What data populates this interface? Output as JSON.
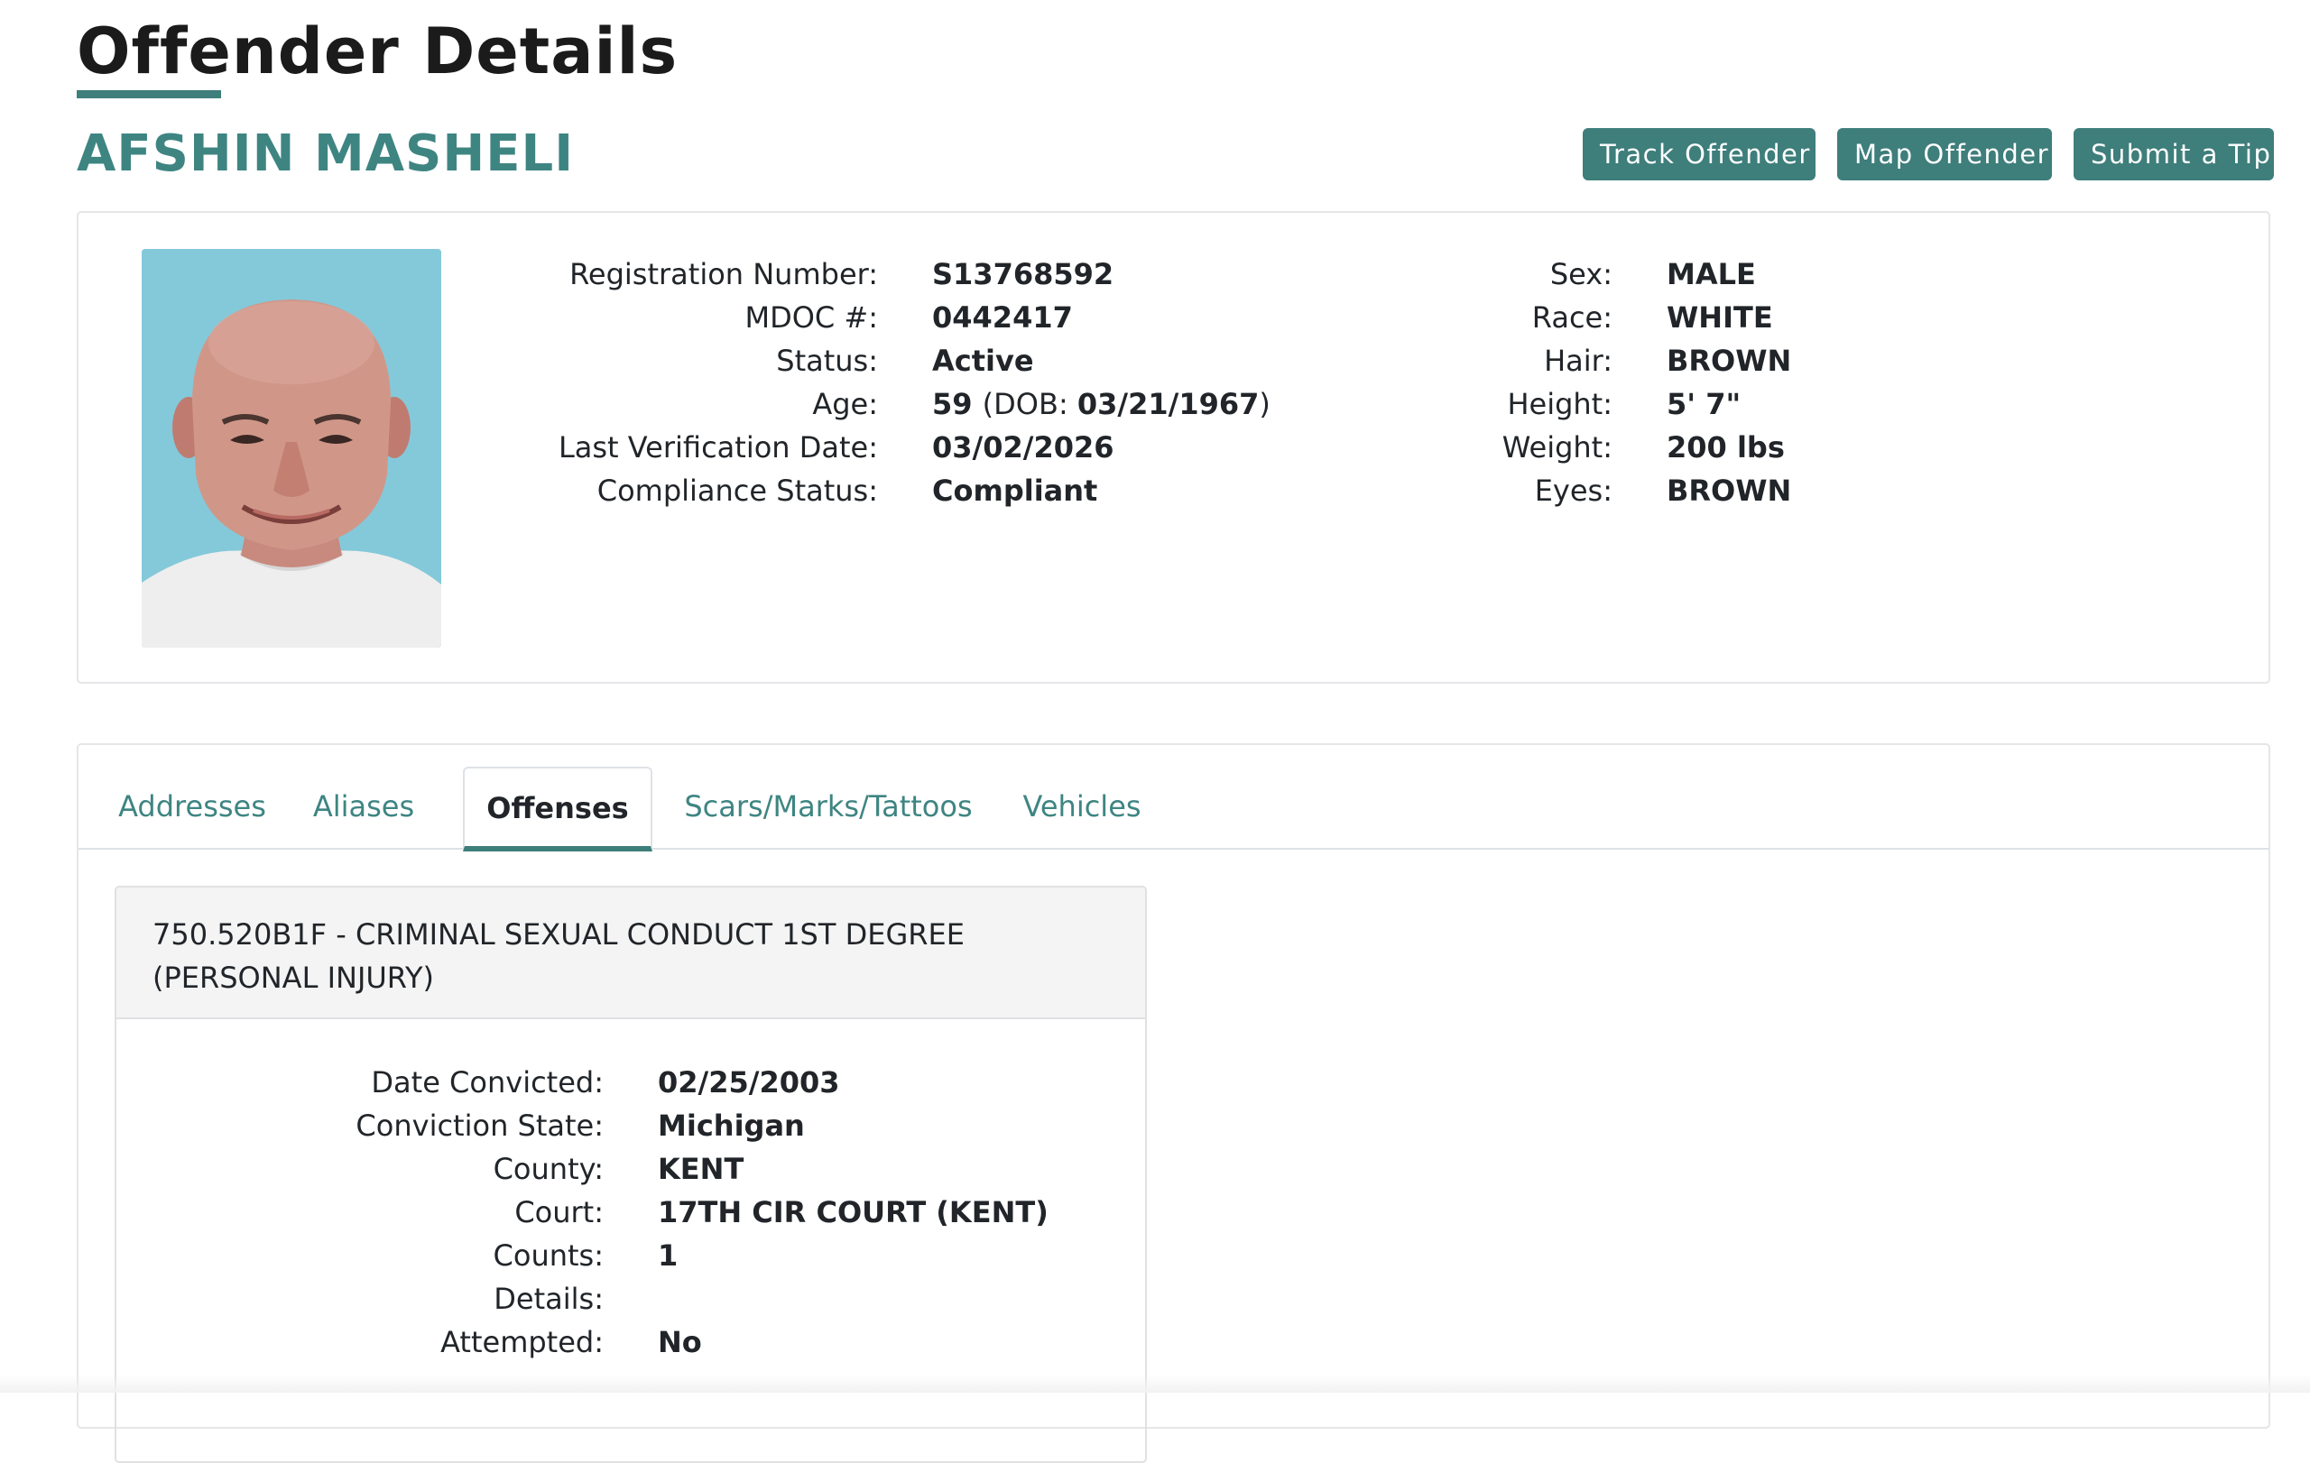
{
  "page": {
    "title": "Offender Details",
    "offender_name": "AFSHIN MASHELI"
  },
  "actions": {
    "track_label": "Track Offender",
    "map_label": "Map Offender",
    "tip_label": "Submit a Tip"
  },
  "profile": {
    "photo_alt": "offender photo",
    "left": [
      {
        "label": "Registration Number:",
        "value": "S13768592"
      },
      {
        "label": "MDOC #:",
        "value": "0442417"
      },
      {
        "label": "Status:",
        "value": "Active"
      },
      {
        "label": "Age:",
        "value": "59",
        "dob_prefix": "(DOB: ",
        "dob": "03/21/1967",
        "dob_suffix": ")"
      },
      {
        "label": "Last Verification Date:",
        "value": "03/02/2026"
      },
      {
        "label": "Compliance Status:",
        "value": "Compliant"
      }
    ],
    "right": [
      {
        "label": "Sex:",
        "value": "MALE"
      },
      {
        "label": "Race:",
        "value": "WHITE"
      },
      {
        "label": "Hair:",
        "value": "BROWN"
      },
      {
        "label": "Height:",
        "value": "5' 7\""
      },
      {
        "label": "Weight:",
        "value": "200 lbs"
      },
      {
        "label": "Eyes:",
        "value": "BROWN"
      }
    ]
  },
  "tabs": [
    {
      "label": "Addresses",
      "active": false
    },
    {
      "label": "Aliases",
      "active": false
    },
    {
      "label": "Offenses",
      "active": true
    },
    {
      "label": "Scars/Marks/Tattoos",
      "active": false
    },
    {
      "label": "Vehicles",
      "active": false
    }
  ],
  "offense": {
    "title": "750.520B1F - CRIMINAL SEXUAL CONDUCT 1ST DEGREE (PERSONAL INJURY)",
    "fields": [
      {
        "label": "Date Convicted:",
        "value": "02/25/2003"
      },
      {
        "label": "Conviction State:",
        "value": "Michigan"
      },
      {
        "label": "County:",
        "value": "KENT"
      },
      {
        "label": "Court:",
        "value": "17TH CIR COURT (KENT)"
      },
      {
        "label": "Counts:",
        "value": "1"
      },
      {
        "label": "Details:",
        "value": ""
      },
      {
        "label": "Attempted:",
        "value": "No"
      }
    ]
  },
  "colors": {
    "accent": "#3e7e7b",
    "name": "#3e8582",
    "photo_background": "#7fc7d8"
  }
}
